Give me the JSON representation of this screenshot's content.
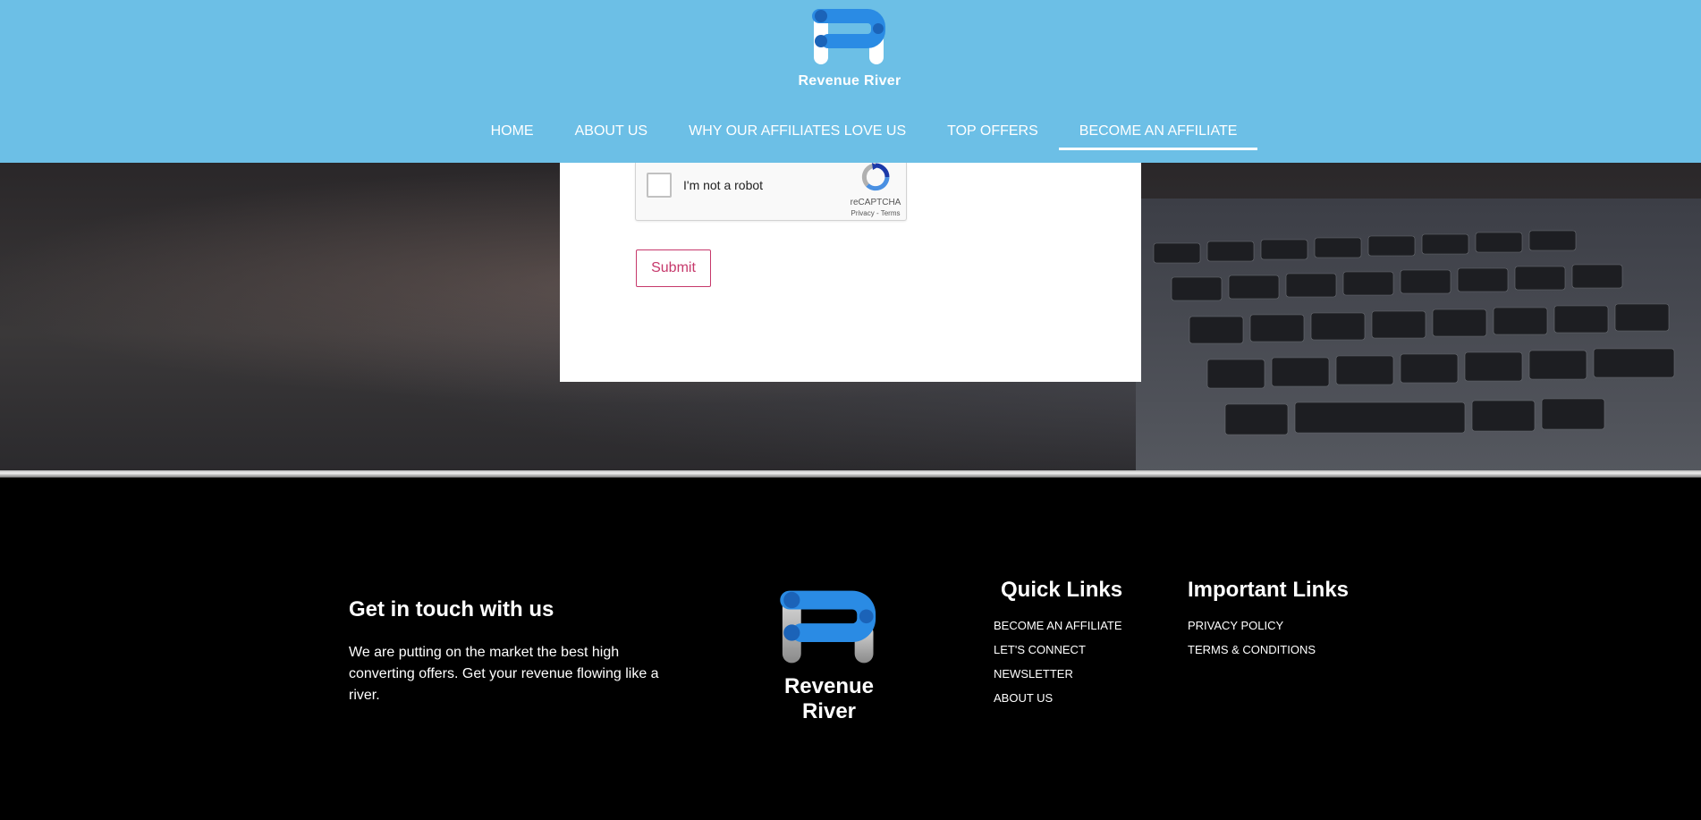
{
  "brand": {
    "name": "Revenue River",
    "primary_color": "#2a8be4",
    "header_color": "#6cbfe6"
  },
  "nav": {
    "items": [
      {
        "label": "HOME"
      },
      {
        "label": "ABOUT US"
      },
      {
        "label": "WHY OUR AFFILIATES LOVE US"
      },
      {
        "label": "TOP OFFERS"
      },
      {
        "label": "BECOME AN AFFILIATE",
        "active": true
      }
    ]
  },
  "form": {
    "captcha_label": "I'm not a robot",
    "captcha_brand": "reCAPTCHA",
    "captcha_terms": "Privacy - Terms",
    "submit_label": "Submit",
    "submit_color": "#c6386b"
  },
  "footer": {
    "contact_title": "Get in touch with us",
    "contact_text": "We are putting on the market the best high converting offers. Get your revenue flowing like a river.",
    "quick_links": {
      "title": "Quick Links",
      "items": [
        "BECOME AN AFFILIATE",
        "LET'S CONNECT",
        "NEWSLETTER",
        "ABOUT US"
      ]
    },
    "important_links": {
      "title": "Important Links",
      "items": [
        "PRIVACY POLICY",
        "TERMS & CONDITIONS"
      ]
    }
  }
}
